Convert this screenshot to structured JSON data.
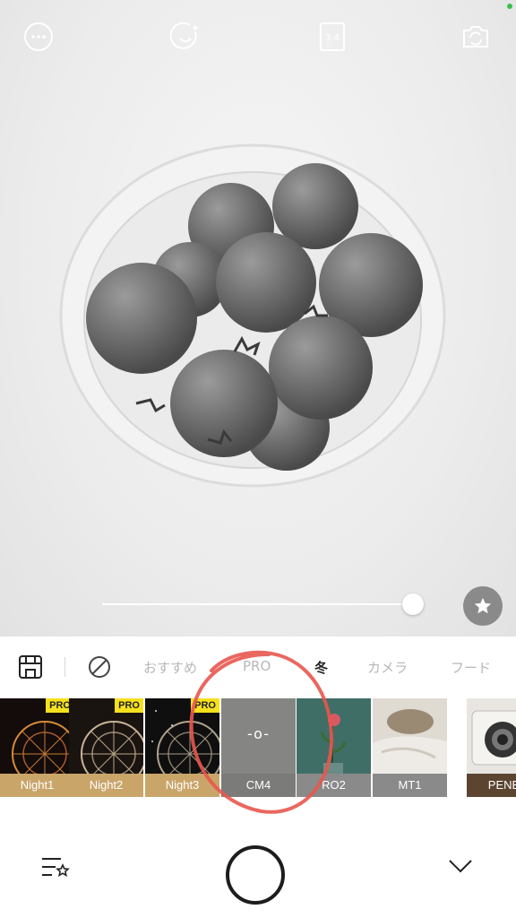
{
  "top_bar": {
    "menu_icon": "more-dots-icon",
    "beauty_icon": "smile-sparkle-icon",
    "ratio_label": "3:4",
    "flip_icon": "camera-flip-icon"
  },
  "preview": {
    "intensity_percent": 100,
    "favorite_icon": "star-icon"
  },
  "categories": {
    "layout_icon": "storefront-icon",
    "none_icon": "no-filter-icon",
    "items": [
      {
        "label": "おすすめ",
        "active": false
      },
      {
        "label": "PRO",
        "active": false
      },
      {
        "label": "冬",
        "active": true
      },
      {
        "label": "カメラ",
        "active": false
      },
      {
        "label": "フード",
        "active": false
      }
    ]
  },
  "filters": [
    {
      "label": "Night1",
      "pro": true,
      "badge": "PRO"
    },
    {
      "label": "Night2",
      "pro": true,
      "badge": "PRO"
    },
    {
      "label": "Night3",
      "pro": true,
      "badge": "PRO"
    },
    {
      "label": "CM4",
      "pro": false,
      "selected": true,
      "symbol": "-o-"
    },
    {
      "label": "RO2",
      "pro": false
    },
    {
      "label": "MT1",
      "pro": false
    },
    {
      "label": "PENE",
      "pro": false
    }
  ],
  "bottom_bar": {
    "list_icon": "list-star-icon",
    "shutter_icon": "shutter-button",
    "collapse_icon": "chevron-down-icon"
  },
  "colors": {
    "pro_badge": "#f6e11e",
    "annotation": "#e8574e",
    "night_label": "#c9a56a"
  }
}
